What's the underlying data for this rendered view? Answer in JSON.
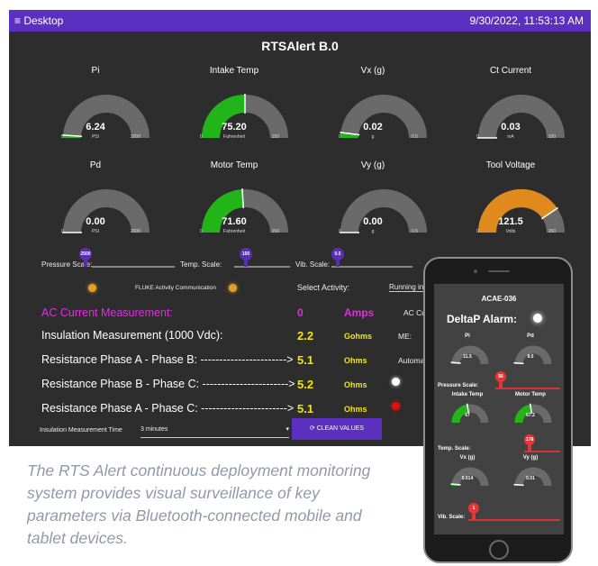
{
  "topbar": {
    "menu_label": "≡ Desktop",
    "clock": "9/30/2022, 11:53:13 AM"
  },
  "app_title": "RTSAlert B.0",
  "gauges": [
    {
      "label": "Pi",
      "value": "6.24",
      "unit": "PSI",
      "min": "0",
      "max": "2500",
      "fraction": 0.02,
      "color": "#22b51a"
    },
    {
      "label": "Intake Temp",
      "value": "75.20",
      "unit": "Fahrenheit",
      "min": "0",
      "max": "150",
      "fraction": 0.5,
      "color": "#22b51a"
    },
    {
      "label": "Vx (g)",
      "value": "0.02",
      "unit": "g",
      "min": "0",
      "max": "0.5",
      "fraction": 0.04,
      "color": "#22b51a"
    },
    {
      "label": "Ct Current",
      "value": "0.03",
      "unit": "mA",
      "min": "0",
      "max": "100",
      "fraction": 0.0,
      "color": "#22b51a"
    },
    {
      "label": "Pd",
      "value": "0.00",
      "unit": "PSI",
      "min": "0",
      "max": "2000",
      "fraction": 0.0,
      "color": "#22b51a"
    },
    {
      "label": "Motor Temp",
      "value": "71.60",
      "unit": "Fahrenheit",
      "min": "0",
      "max": "150",
      "fraction": 0.48,
      "color": "#22b51a"
    },
    {
      "label": "Vy (g)",
      "value": "0.00",
      "unit": "g",
      "min": "0",
      "max": "0.5",
      "fraction": 0.0,
      "color": "#22b51a"
    },
    {
      "label": "Tool Voltage",
      "value": "121.5",
      "unit": "Volts",
      "min": "0",
      "max": "150",
      "fraction": 0.81,
      "color": "#e08a1e"
    }
  ],
  "sliders": [
    {
      "label": "Pressure Scale:",
      "value": "2500"
    },
    {
      "label": "Temp. Scale:",
      "value": "150"
    },
    {
      "label": "Vib. Scale:",
      "value": "0.5"
    }
  ],
  "activity": {
    "fluke_label": "FLUKE Activity Communication",
    "select_label": "Select Activity:",
    "select_value": "Running in"
  },
  "ac_current": {
    "label": "AC Current Measurement:",
    "value": "0",
    "unit": "Amps",
    "side": "AC Cu"
  },
  "rows": [
    {
      "label": "Insulation Measurement (1000 Vdc):",
      "value": "2.2",
      "unit": "Gohms",
      "side": "ME:"
    },
    {
      "label": "Resistance Phase A - Phase B: ----------------------->",
      "value": "5.1",
      "unit": "Ohms",
      "side": "Automatic"
    },
    {
      "label": "Resistance Phase B - Phase C: ----------------------->",
      "value": "5.2",
      "unit": "Ohms",
      "side": ""
    },
    {
      "label": "Resistance Phase A - Phase C: ----------------------->",
      "value": "5.1",
      "unit": "Ohms",
      "side": ""
    }
  ],
  "bottom": {
    "time_label": "Insulation Measurement Time",
    "time_value": "3 minutes",
    "clean_button": "CLEAN VALUES"
  },
  "caption": "The RTS Alert continuous deployment monitoring system provides visual surveillance of key parameters via Bluetooth-connected mobile and tablet devices.",
  "phone": {
    "title": "ACAE-036",
    "alarm": "DeltaP Alarm:",
    "gauges": [
      {
        "label": "Pi",
        "value": "11.5",
        "fraction": 0.03
      },
      {
        "label": "Pd",
        "value": "9.0",
        "fraction": 0.02
      },
      {
        "label": "Intake Temp",
        "value": "67",
        "fraction": 0.45
      },
      {
        "label": "Motor Temp",
        "value": "67.2",
        "fraction": 0.45
      },
      {
        "label": "Vx (g)",
        "value": "0.014",
        "fraction": 0.03
      },
      {
        "label": "Vy (g)",
        "value": "0.01",
        "fraction": 0.02
      }
    ],
    "sliders": [
      {
        "label": "Pressure Scale:",
        "value": "56"
      },
      {
        "label": "Temp. Scale:",
        "value": "178"
      },
      {
        "label": "Vib. Scale:",
        "value": "1"
      }
    ]
  },
  "colors": {
    "accent": "#5b2fbf",
    "panel": "#2d2d2d",
    "gauge_green": "#22b51a",
    "gauge_orange": "#e08a1e",
    "magenta": "#e02ee0",
    "value_yellow": "#f5e600"
  }
}
